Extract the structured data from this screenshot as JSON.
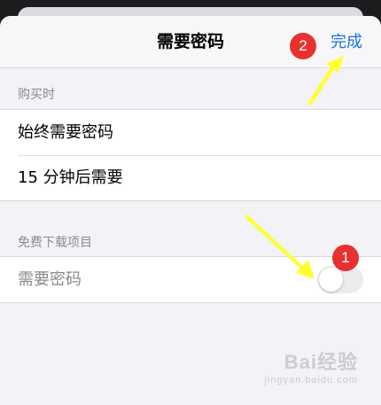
{
  "navbar": {
    "title": "需要密码",
    "done_label": "完成"
  },
  "purchase_section": {
    "header": "购买时",
    "options": [
      "始终需要密码",
      "15 分钟后需要"
    ]
  },
  "free_download_section": {
    "header": "免费下载项目",
    "row_label": "需要密码",
    "toggle_on": false
  },
  "annotations": {
    "badge_1": "1",
    "badge_2": "2",
    "arrow_color": "#ffff33",
    "badge_color": "#e8312f"
  },
  "watermark": {
    "brand": "Bai经验",
    "url": "jingyan.baidu.com"
  },
  "colors": {
    "accent": "#1a73e8"
  }
}
